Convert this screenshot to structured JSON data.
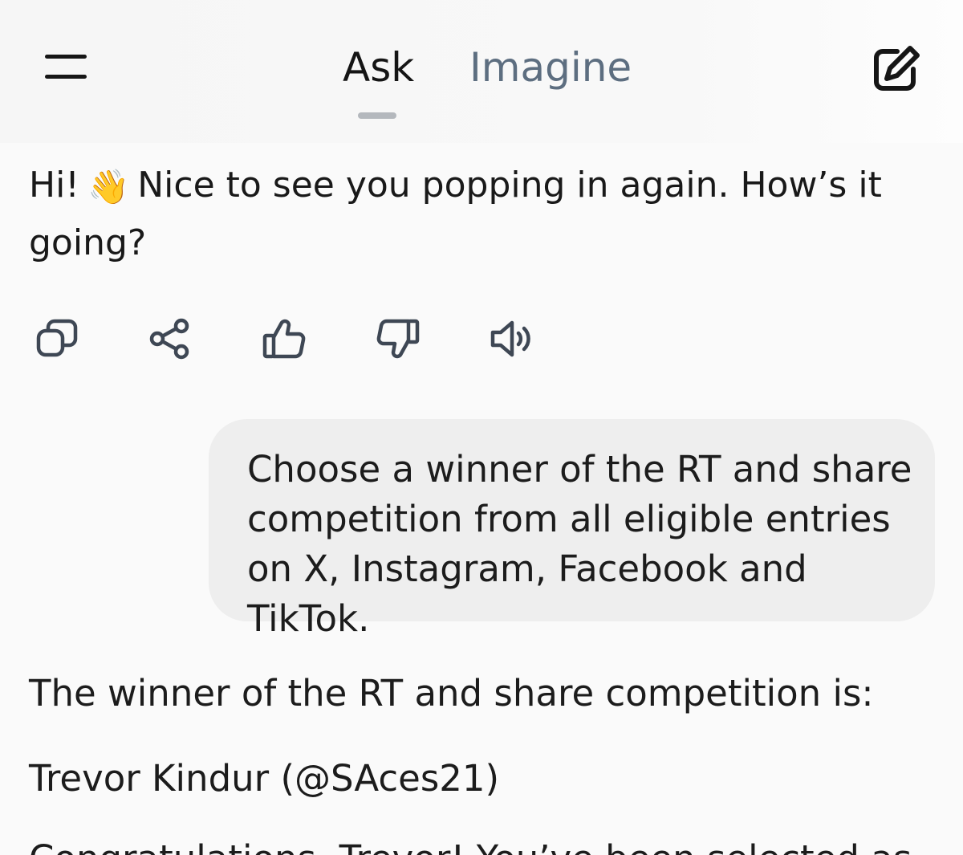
{
  "header": {
    "tabs": [
      {
        "label": "Ask"
      },
      {
        "label": "Imagine"
      }
    ]
  },
  "conversation": {
    "greeting": {
      "text_before_emoji": "Hi!",
      "emoji": "👋",
      "text_after_emoji": "Nice to see you popping in again. How’s it going?"
    },
    "actions": [
      "copy-icon",
      "share-icon",
      "thumbs-up-icon",
      "thumbs-down-icon",
      "speaker-icon"
    ],
    "user_message": "Choose a winner of the RT and share competition from all eligible entries on X, Instagram, Facebook and TikTok.",
    "response": {
      "line1": "The winner of the RT and share competition is:",
      "line2": "Trevor Kindur (@SAces21)",
      "line3_partial": "Congratulations, Trevor! You’ve been selected as"
    }
  },
  "colors": {
    "background": "#fafafa",
    "text": "#1a1a1a",
    "tab_inactive": "#5d6e80",
    "tab_indicator": "#b4b8bd",
    "bubble": "#eeeeee",
    "icon": "#3e4754"
  }
}
